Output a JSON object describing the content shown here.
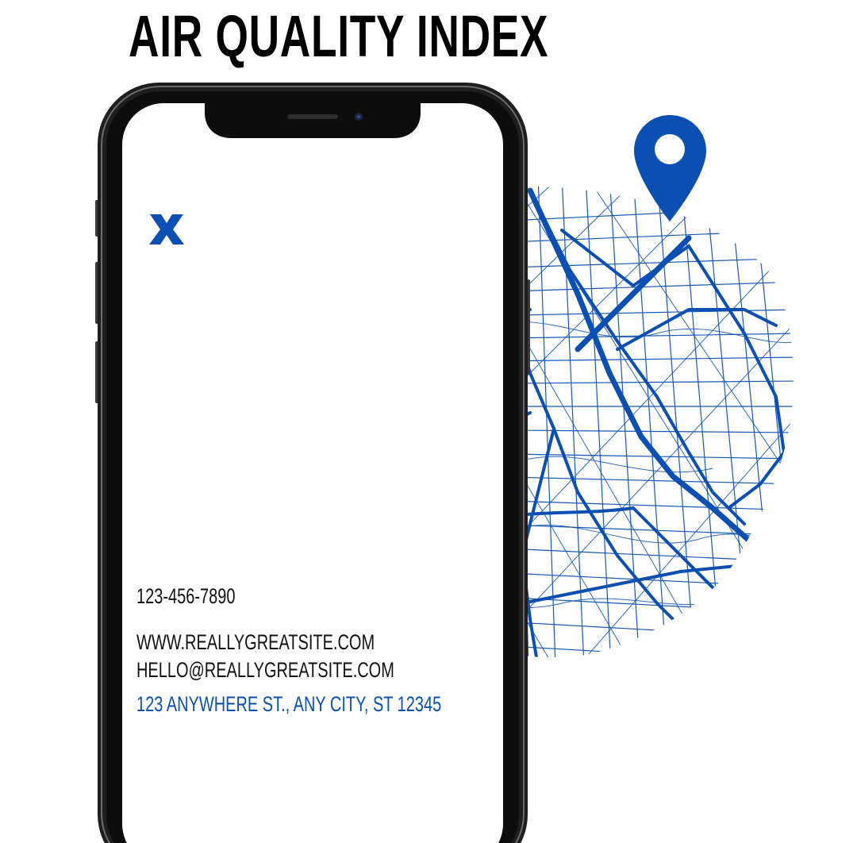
{
  "title": "AIR QUALITY INDEX",
  "contact": {
    "phone": "123-456-7890",
    "website": "WWW.REALLYGREATSITE.COM",
    "email": "HELLO@REALLYGREATSITE.COM",
    "address": "123 ANYWHERE ST., ANY CITY, ST 12345"
  },
  "icons": {
    "logo": "x-logo-icon",
    "pin": "location-pin-icon",
    "map": "city-map-illustration"
  },
  "colors": {
    "accent": "#0b4fb3",
    "text": "#111111",
    "background": "#ffffff",
    "phone_frame": "#2a2a2a"
  }
}
